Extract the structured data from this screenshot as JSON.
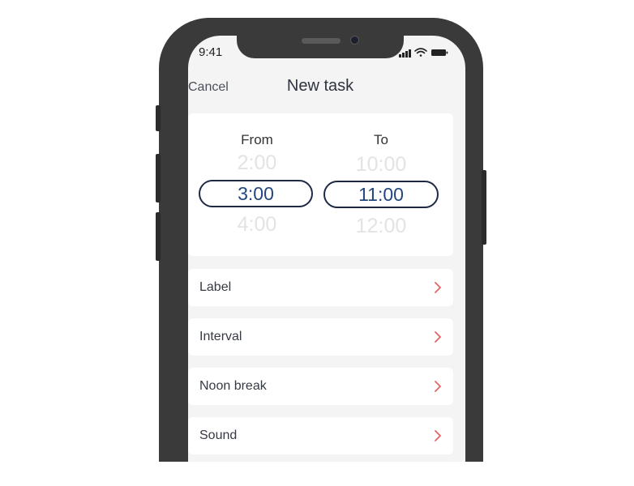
{
  "status_bar": {
    "time": "9:41"
  },
  "nav": {
    "cancel": "Cancel",
    "title": "New task"
  },
  "picker": {
    "from": {
      "header": "From",
      "prev": "2:00",
      "selected": "3:00",
      "next": "4:00"
    },
    "to": {
      "header": "To",
      "prev": "10:00",
      "selected": "11:00",
      "next": "12:00"
    }
  },
  "settings": [
    {
      "label": "Label"
    },
    {
      "label": "Interval"
    },
    {
      "label": "Noon break"
    },
    {
      "label": "Sound"
    }
  ],
  "colors": {
    "accent": "#e46464",
    "selection_text": "#23467f",
    "selection_border": "#1e2a44"
  },
  "icons": {
    "row_chevron": "chevron-right-icon"
  }
}
